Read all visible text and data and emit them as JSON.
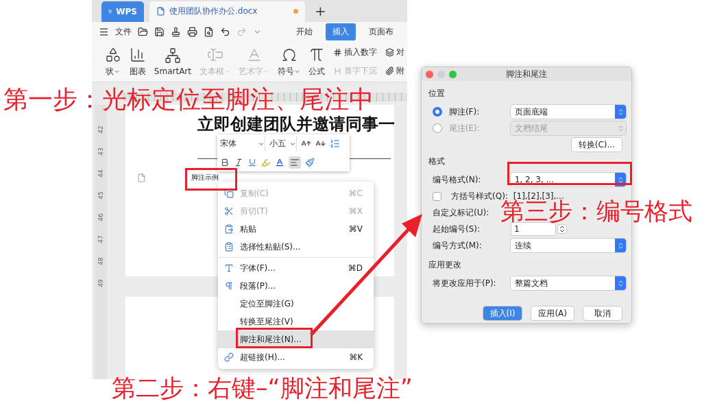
{
  "app_window": {
    "tabs": [
      {
        "kind": "home",
        "label": "WPS",
        "selected": false,
        "unsaved": false
      },
      {
        "kind": "document",
        "label": "使用团队协作办公.docx",
        "selected": true,
        "unsaved": true
      }
    ],
    "new_tab": "+",
    "file_menu": "文件",
    "ribbon_tabs": [
      {
        "label": "开始",
        "selected": false
      },
      {
        "label": "插入",
        "selected": true
      },
      {
        "label": "页面布",
        "selected": false
      }
    ],
    "ribbon_tools": [
      {
        "label": "状",
        "dropdown": true,
        "disabled": false
      },
      {
        "label": "图表",
        "dropdown": false,
        "disabled": false
      },
      {
        "label": "SmartArt",
        "dropdown": false,
        "disabled": false
      },
      {
        "label": "文本框",
        "dropdown": true,
        "disabled": true
      },
      {
        "label": "艺术字",
        "dropdown": true,
        "disabled": true
      },
      {
        "label": "符号",
        "dropdown": true,
        "disabled": false
      },
      {
        "label": "公式",
        "dropdown": false,
        "disabled": false
      }
    ],
    "ribbon_small_tools": [
      {
        "label": "插入数字",
        "disabled": false
      },
      {
        "label": "首字下沉",
        "disabled": true
      },
      {
        "label": "对",
        "disabled": false
      },
      {
        "label": "附",
        "disabled": false
      }
    ],
    "vertical_ruler": [
      "42",
      "43",
      "44",
      "45",
      "46",
      "47",
      "48",
      "49"
    ],
    "document": {
      "heading": "立即创建团队并邀请同事一",
      "footnote": "脚注示例"
    },
    "mini_toolbar": {
      "font": "宋体",
      "size": "小五"
    },
    "context_menu": [
      {
        "label": "复制(C)",
        "shortcut": "⌘C",
        "disabled": true,
        "selected": false,
        "divider_above": false
      },
      {
        "label": "剪切(T)",
        "shortcut": "⌘X",
        "disabled": true,
        "selected": false,
        "divider_above": false
      },
      {
        "label": "粘贴",
        "shortcut": "⌘V",
        "disabled": false,
        "selected": false,
        "divider_above": false
      },
      {
        "label": "选择性粘贴(S)...",
        "disabled": false,
        "selected": false,
        "divider_above": false
      },
      {
        "label": "字体(F)...",
        "shortcut": "⌘D",
        "disabled": false,
        "selected": false,
        "divider_above": true
      },
      {
        "label": "段落(P)...",
        "disabled": false,
        "selected": false,
        "divider_above": false
      },
      {
        "label": "定位至脚注(G)",
        "disabled": false,
        "selected": false,
        "divider_above": false
      },
      {
        "label": "转换至尾注(V)",
        "disabled": false,
        "selected": false,
        "divider_above": false
      },
      {
        "label": "脚注和尾注(N)...",
        "disabled": false,
        "selected": true,
        "divider_above": false
      },
      {
        "label": "超链接(H)...",
        "shortcut": "⌘K",
        "disabled": false,
        "selected": false,
        "divider_above": false
      }
    ]
  },
  "dialog": {
    "title": "脚注和尾注",
    "position_heading": "位置",
    "location_options": [
      {
        "label": "脚注(F):",
        "selected": true,
        "value": "页面底端"
      },
      {
        "label": "尾注(E):",
        "selected": false,
        "value": "文档结尾"
      }
    ],
    "convert_button": "转换(C)...",
    "format_heading": "格式",
    "number_format": {
      "label": "编号格式(N):",
      "value": "1, 2, 3, ..."
    },
    "bracket_style": {
      "label": "方括号样式(Q):",
      "checked": false,
      "sample": "[1],[2],[3],..."
    },
    "custom_mark": {
      "label": "自定义标记(U):"
    },
    "start_at": {
      "label": "起始编号(S):",
      "value": "1"
    },
    "numbering": {
      "label": "编号方式(M):",
      "value": "连续"
    },
    "apply_heading": "应用更改",
    "apply_to": {
      "label": "将更改应用于(P):",
      "value": "整篇文档"
    },
    "buttons": [
      {
        "label": "插入(I)",
        "default": true
      },
      {
        "label": "应用(A)",
        "default": false
      },
      {
        "label": "取消",
        "default": false
      }
    ]
  },
  "steps": [
    "第一步：光标定位至脚注、尾注中",
    "第二步：右键–“脚注和尾注”",
    "第三步：编号格式"
  ]
}
